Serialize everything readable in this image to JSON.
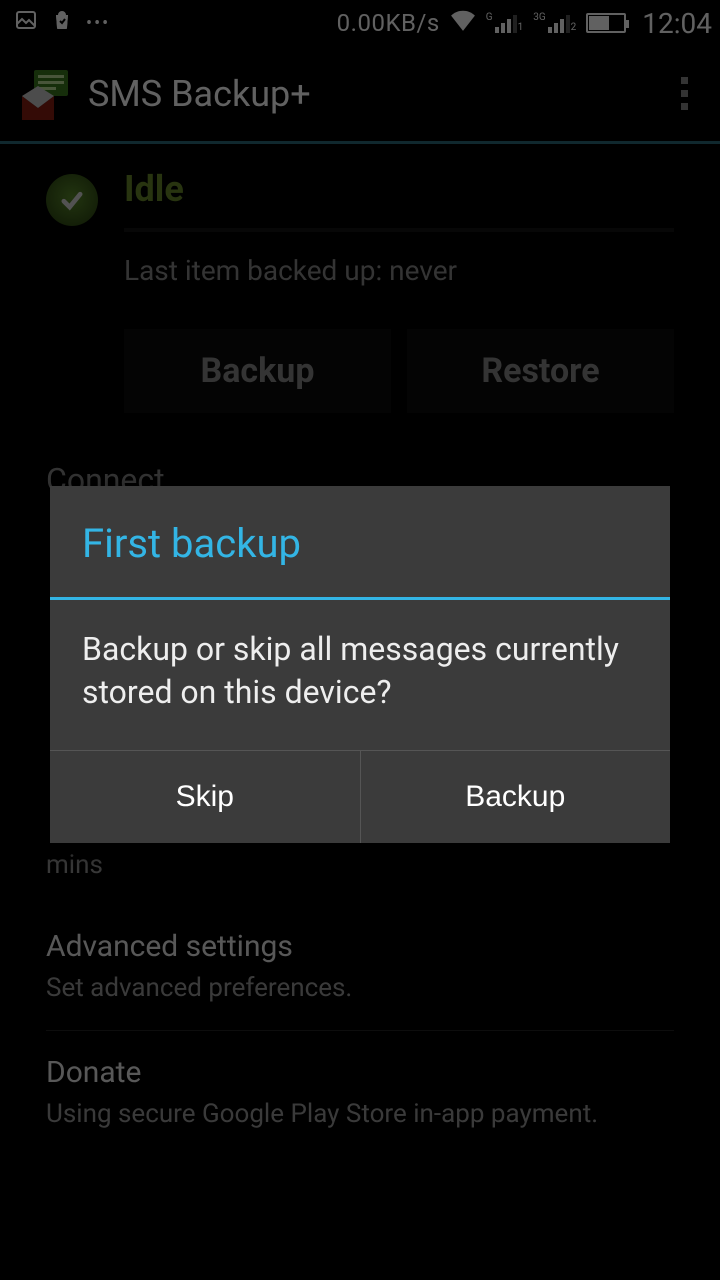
{
  "status_bar": {
    "speed": "0.00KB/s",
    "signal1_sup": "G",
    "signal1_sub": "1",
    "signal2_sup": "3G",
    "signal2_sub": "2",
    "clock": "12:04"
  },
  "app_bar": {
    "title": "SMS Backup+"
  },
  "main": {
    "status_label": "Idle",
    "last_item": "Last item backed up: never",
    "backup_btn": "Backup",
    "restore_btn": "Restore",
    "section_header": "Connect",
    "mins_fragment": "mins",
    "pref": {
      "advanced_title": "Advanced settings",
      "advanced_sub": "Set advanced preferences.",
      "donate_title": "Donate",
      "donate_sub": "Using secure Google Play Store in-app payment."
    }
  },
  "dialog": {
    "title": "First backup",
    "body": "Backup or skip all messages currently stored on this device?",
    "skip": "Skip",
    "backup": "Backup"
  }
}
